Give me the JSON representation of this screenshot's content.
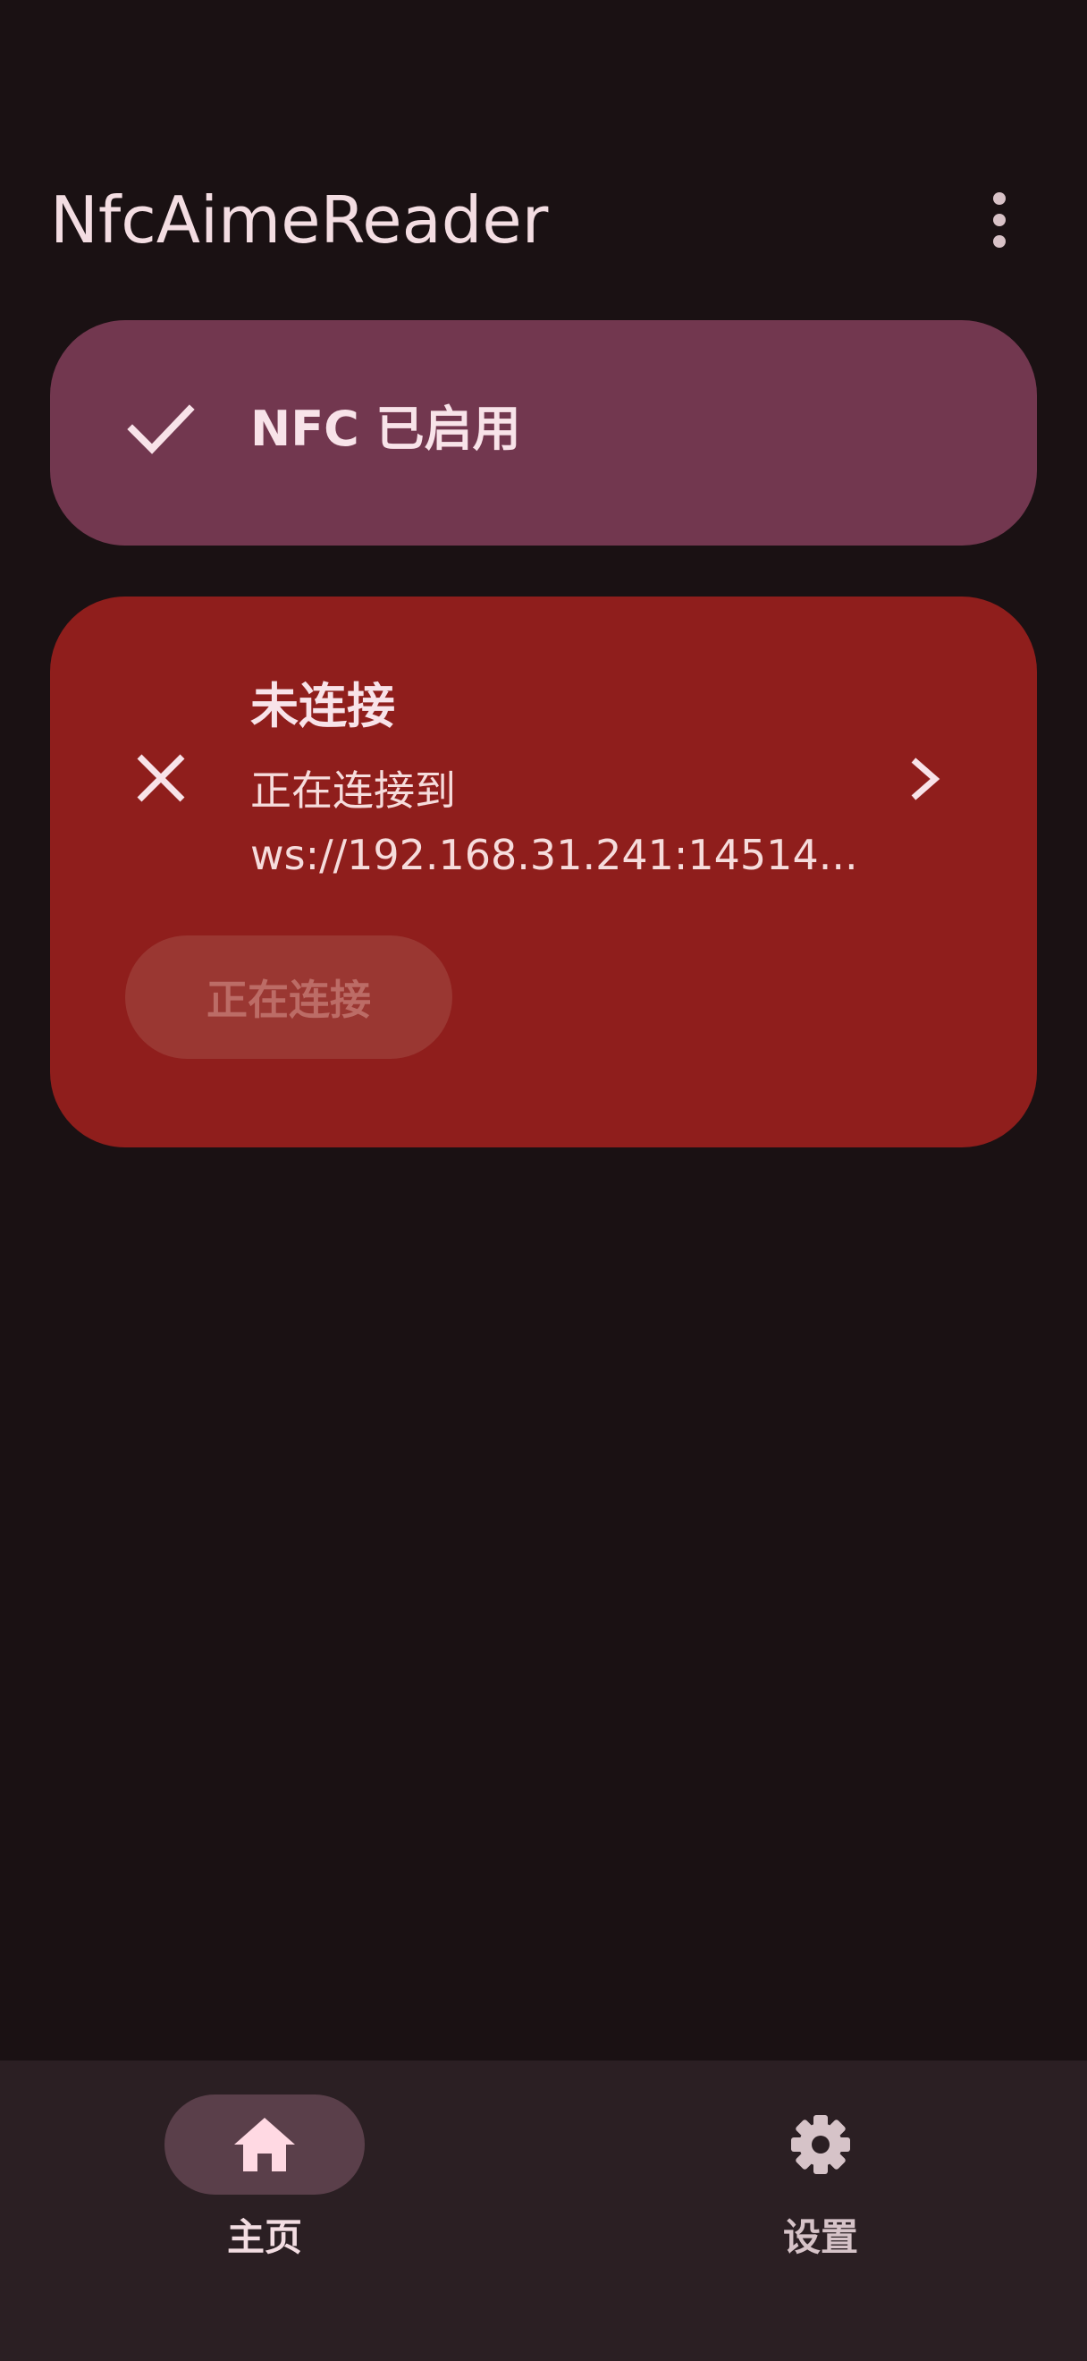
{
  "app": {
    "title": "NfcAimeReader"
  },
  "nfc_card": {
    "label": "NFC 已启用",
    "icon": "check-icon"
  },
  "connection_card": {
    "title": "未连接",
    "subtitle_line1": "正在连接到",
    "subtitle_line2": "ws://192.168.31.241:14514...",
    "status_icon": "close-icon",
    "action_icon": "chevron-right-icon",
    "button_label": "正在连接"
  },
  "bottom_nav": {
    "items": [
      {
        "label": "主页",
        "icon": "home-icon",
        "selected": true
      },
      {
        "label": "设置",
        "icon": "gear-icon",
        "selected": false
      }
    ]
  },
  "colors": {
    "background": "#1a1113",
    "nfc_card": "#72374f",
    "connection_card": "#8f1e1c",
    "nav_bar": "#2b1f23",
    "nav_selected_pill": "#5a3f4a"
  }
}
